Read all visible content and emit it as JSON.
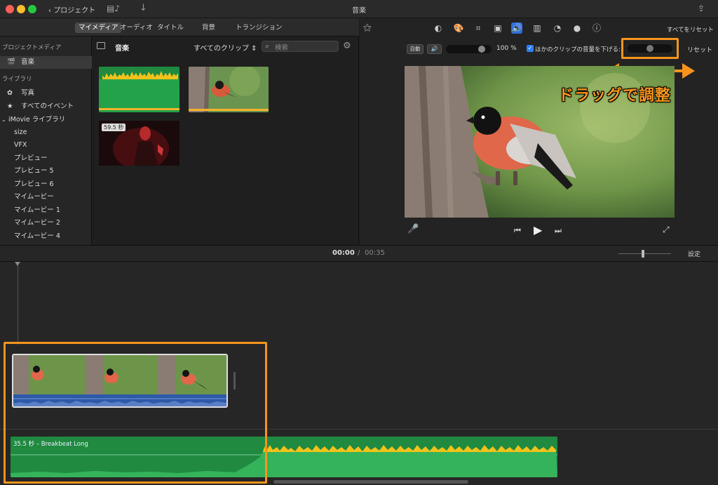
{
  "window": {
    "title": "音楽",
    "back_label": "プロジェクト"
  },
  "browser_tabs": [
    "マイメディア",
    "オーディオ",
    "タイトル",
    "背景",
    "トランジション"
  ],
  "sidebar": {
    "project_media_heading": "プロジェクトメディア",
    "project_item": "音楽",
    "library_heading": "ライブラリ",
    "library_items": [
      "写真",
      "すべてのイベント"
    ],
    "imovie_library": "iMovie ライブラリ",
    "events": [
      "size",
      "VFX",
      "プレビュー",
      "プレビュー 5",
      "プレビュー 6",
      "マイムービー",
      "マイムービー 1",
      "マイムービー 2",
      "マイムービー 4"
    ]
  },
  "browser": {
    "title": "音楽",
    "filter": "すべてのクリップ",
    "search_placeholder": "検索",
    "clip_duration_badge": "59.5 秒"
  },
  "viewer": {
    "reset_all": "すべてをリセット",
    "auto_button": "自動",
    "volume_percent": "100",
    "percent_sign": "%",
    "duck_label": "ほかのクリップの音量を下げる:",
    "duck_checked": true,
    "reset": "リセット",
    "volume_level": 0.83,
    "duck_level": 0.5
  },
  "annotation": {
    "text": "ドラッグで調整"
  },
  "timeline": {
    "current_time": "00:00",
    "separator": "/",
    "total_time": "00:35",
    "settings": "設定",
    "music_clip_label": "35.5 秒 – Breakbeat Long"
  },
  "colors": {
    "accent": "#f7941d",
    "audio_green": "#1fa34b",
    "audio_blue": "#2d5aa8",
    "selection_blue": "#0a84ff"
  }
}
